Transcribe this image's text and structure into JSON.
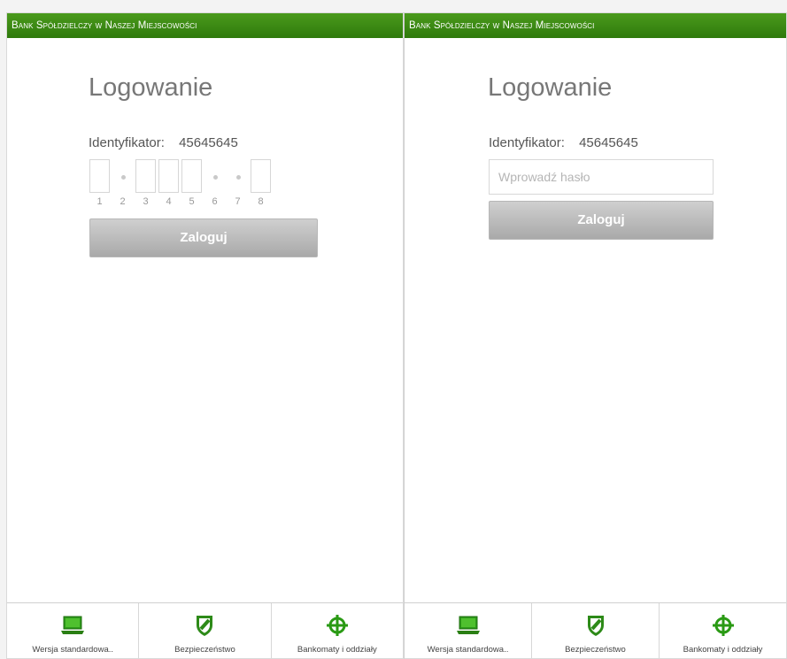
{
  "screens": [
    {
      "bank_name": "Bank Spółdzielczy w Naszej Miejscowości",
      "title": "Logowanie",
      "identifier_label": "Identyfikator:",
      "identifier_value": "45645645",
      "pin_numbers": [
        "1",
        "2",
        "3",
        "4",
        "5",
        "6",
        "7",
        "8"
      ],
      "pin_masked": [
        false,
        true,
        false,
        false,
        false,
        true,
        true,
        false
      ],
      "login_label": "Zaloguj"
    },
    {
      "bank_name": "Bank Spółdzielczy w Naszej Miejscowości",
      "title": "Logowanie",
      "identifier_label": "Identyfikator:",
      "identifier_value": "45645645",
      "password_placeholder": "Wprowadź hasło",
      "login_label": "Zaloguj"
    }
  ],
  "footer": {
    "items": [
      {
        "label": "Wersja standardowa..",
        "icon": "laptop-icon"
      },
      {
        "label": "Bezpieczeństwo",
        "icon": "shield-icon"
      },
      {
        "label": "Bankomaty i oddziały",
        "icon": "crosshair-icon"
      }
    ]
  },
  "colors": {
    "brand_green": "#3a8a12",
    "button_gray": "#bdbdbd"
  }
}
